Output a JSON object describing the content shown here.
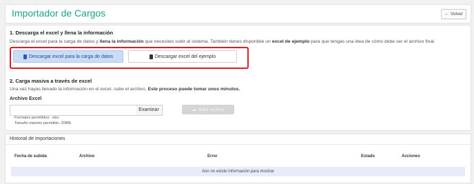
{
  "header": {
    "title": "Importador de Cargos",
    "back_label": "Volver"
  },
  "section1": {
    "title": "1. Descarga el excel y llena la información",
    "desc_part1": "Descarga el excel para la carga de datos y ",
    "desc_bold1": "llena la información",
    "desc_part2": " que necesites subir al sistema. También tienes disponible un ",
    "desc_bold2": "excel de ejemplo",
    "desc_part3": " para que tengas una idea de cómo debe ser el archivo final.",
    "download_data_label": "Descargar excel para la carga de datos",
    "download_example_label": "Descargar excel del ejemplo"
  },
  "section2": {
    "title": "2. Carga masiva a través de excel",
    "desc": "Una vez hayas llenado la información en el excel, sube el archivo. ",
    "desc_bold": "Este proceso puede tomar unos minutos.",
    "file_label": "Archivo Excel",
    "file_value": "",
    "browse_label": "Examinar",
    "upload_label": "Subir archivo",
    "hint_formats": "Formatos permitidos: .xlsx.",
    "hint_size": "Tamaño máximo permitido: 20MB."
  },
  "history": {
    "title": "Historial de importaciones",
    "columns": [
      "Fecha de subida",
      "Archivo",
      "Error",
      "Estado",
      "Acciones"
    ],
    "empty_message": "Aún no existe información para mostrar"
  },
  "colors": {
    "accent": "#1aa38a",
    "highlight": "#e21b24",
    "primary_button": "#c9dcf8"
  }
}
